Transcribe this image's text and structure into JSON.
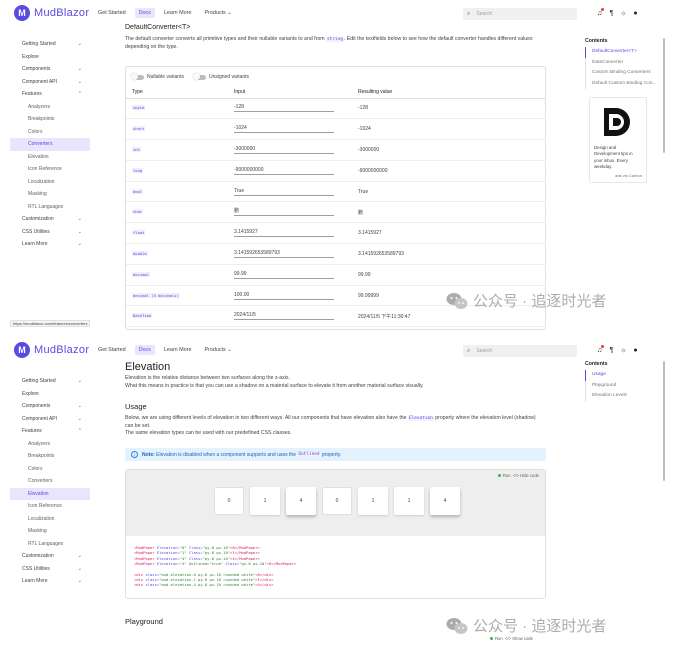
{
  "app": {
    "logo_text": "MudBlazor",
    "nav": [
      "Get Started",
      "Docs",
      "Learn More",
      "Products"
    ],
    "search_placeholder": "Search",
    "nav_chevron": "⌄"
  },
  "sidebar1": [
    {
      "label": "Getting Started",
      "chev": "⌄",
      "sub": false,
      "active": false
    },
    {
      "label": "Explore",
      "chev": "",
      "sub": false,
      "active": false
    },
    {
      "label": "Components",
      "chev": "⌄",
      "sub": false,
      "active": false
    },
    {
      "label": "Component API",
      "chev": "⌄",
      "sub": false,
      "active": false
    },
    {
      "label": "Features",
      "chev": "⌃",
      "sub": false,
      "active": false
    },
    {
      "label": "Analyzers",
      "chev": "",
      "sub": true,
      "active": false
    },
    {
      "label": "Breakpoints",
      "chev": "",
      "sub": true,
      "active": false
    },
    {
      "label": "Colors",
      "chev": "",
      "sub": true,
      "active": false
    },
    {
      "label": "Converters",
      "chev": "",
      "sub": true,
      "active": true
    },
    {
      "label": "Elevation",
      "chev": "",
      "sub": true,
      "active": false
    },
    {
      "label": "Icon Reference",
      "chev": "",
      "sub": true,
      "active": false
    },
    {
      "label": "Localization",
      "chev": "",
      "sub": true,
      "active": false
    },
    {
      "label": "Masking",
      "chev": "",
      "sub": true,
      "active": false
    },
    {
      "label": "RTL Languages",
      "chev": "",
      "sub": true,
      "active": false
    },
    {
      "label": "Customization",
      "chev": "⌄",
      "sub": false,
      "active": false
    },
    {
      "label": "CSS Utilities",
      "chev": "⌄",
      "sub": false,
      "active": false
    },
    {
      "label": "Learn More",
      "chev": "⌄",
      "sub": false,
      "active": false
    }
  ],
  "sidebar2": [
    {
      "label": "Getting Started",
      "chev": "⌄",
      "sub": false,
      "active": false
    },
    {
      "label": "Explore",
      "chev": "",
      "sub": false,
      "active": false
    },
    {
      "label": "Components",
      "chev": "⌄",
      "sub": false,
      "active": false
    },
    {
      "label": "Component API",
      "chev": "⌄",
      "sub": false,
      "active": false
    },
    {
      "label": "Features",
      "chev": "⌃",
      "sub": false,
      "active": false
    },
    {
      "label": "Analyzers",
      "chev": "",
      "sub": true,
      "active": false
    },
    {
      "label": "Breakpoints",
      "chev": "",
      "sub": true,
      "active": false
    },
    {
      "label": "Colors",
      "chev": "",
      "sub": true,
      "active": false
    },
    {
      "label": "Converters",
      "chev": "",
      "sub": true,
      "active": false
    },
    {
      "label": "Elevation",
      "chev": "",
      "sub": true,
      "active": true
    },
    {
      "label": "Icon Reference",
      "chev": "",
      "sub": true,
      "active": false
    },
    {
      "label": "Localization",
      "chev": "",
      "sub": true,
      "active": false
    },
    {
      "label": "Masking",
      "chev": "",
      "sub": true,
      "active": false
    },
    {
      "label": "RTL Languages",
      "chev": "",
      "sub": true,
      "active": false
    },
    {
      "label": "Customization",
      "chev": "⌄",
      "sub": false,
      "active": false
    },
    {
      "label": "CSS Utilities",
      "chev": "⌄",
      "sub": false,
      "active": false
    },
    {
      "label": "Learn More",
      "chev": "⌄",
      "sub": false,
      "active": false
    }
  ],
  "toc1": {
    "title": "Contents",
    "items": [
      {
        "label": "DefaultConverter<T>",
        "active": true
      },
      {
        "label": "DateConverter",
        "active": false
      },
      {
        "label": "Custom Binding Converters",
        "active": false
      },
      {
        "label": "Default Custom Binding Con...",
        "active": false
      }
    ]
  },
  "toc2": {
    "title": "Contents",
    "items": [
      {
        "label": "Usage",
        "active": true
      },
      {
        "label": "Playground",
        "active": false
      },
      {
        "label": "Elevation Levels",
        "active": false
      }
    ]
  },
  "ad": {
    "text": "Design and Development tips in your inbox. Every weekday.",
    "via": "ads via Carbon"
  },
  "converters": {
    "heading_partial": "DefaultConverter<T>",
    "desc_a": "The default converter converts all primitive types and their nullable variants to and from",
    "desc_code": "string",
    "desc_b": ". Edit the textfields below to see how the default converter handles different values depending on the type.",
    "switch_nullable": "Nullable variants",
    "switch_unsigned": "Unsigned variants",
    "headers": [
      "Type",
      "Input",
      "Resulting value"
    ],
    "rows": [
      {
        "type": "sbyte",
        "input": "-128",
        "result": "-128"
      },
      {
        "type": "short",
        "input": "-1024",
        "result": "-1024"
      },
      {
        "type": "int",
        "input": "-3000000",
        "result": "-3000000"
      },
      {
        "type": "long",
        "input": "-9000000000",
        "result": "-9000000000"
      },
      {
        "type": "bool",
        "input": "True",
        "result": "True"
      },
      {
        "type": "char",
        "input": "鹏",
        "result": "鹏"
      },
      {
        "type": "float",
        "input": "3.1415927",
        "result": "3.1415927"
      },
      {
        "type": "double",
        "input": "3.141592653589793",
        "result": "3.141592653589793"
      },
      {
        "type": "decimal",
        "input": "99.99",
        "result": "99.99"
      },
      {
        "type": "decimal (5 decimals)",
        "input": "100.00",
        "result": "99.99999"
      },
      {
        "type": "DateTime",
        "input": "2024/11/5",
        "result": "2024/11/5 下午11:30:47"
      }
    ],
    "url": "https://mudblazor.com/features/converters"
  },
  "elevation": {
    "title": "Elevation",
    "desc1": "Elevation is the relative distance between two surfaces along the z-axis.",
    "desc2": "What this means in practice is that you can use a shadow on a material surface to elevate it from another material surface visually.",
    "usage_title": "Usage",
    "usage_a": "Below, we are using different levels of elevation in two different ways. All our components that have elevation also have the",
    "usage_code": "Elevation",
    "usage_b": "property where the elevation level (shadow) can be set.",
    "usage_c": "The same elevation types can be used with our predefined CSS classes.",
    "note_strong": "Note:",
    "note_a": "Elevation is disabled when a component supports and uses the",
    "note_code": "Outlined",
    "note_b": "property.",
    "run": "Run",
    "hide_code": "Hide code",
    "show_code": "Show code",
    "code_sym": "</>",
    "papers": [
      "0",
      "1",
      "4",
      "0",
      "1",
      "1",
      "4"
    ],
    "code_lines": [
      {
        "t": "<MudPaper",
        "a": " Elevation=",
        "s": "\"0\"",
        "a2": " Class=",
        "s2": "\"py-8 px-10\"",
        "e": ">0</MudPaper>"
      },
      {
        "t": "<MudPaper",
        "a": " Elevation=",
        "s": "\"1\"",
        "a2": " Class=",
        "s2": "\"py-8 px-10\"",
        "e": ">1</MudPaper>"
      },
      {
        "t": "<MudPaper",
        "a": " Elevation=",
        "s": "\"4\"",
        "a2": " Class=",
        "s2": "\"py-8 px-10\"",
        "e": ">4</MudPaper>"
      },
      {
        "t": "<MudPaper",
        "a": " Elevation=",
        "s": "\"4\" Outlined=\"true\"",
        "a2": " Class=",
        "s2": "\"py-8 px-10\"",
        "e": ">0</MudPaper>"
      }
    ],
    "div_lines": [
      {
        "t": "<div",
        "a": " class=",
        "s": "\"mud-elevation-0 py-8 px-10 rounded white\"",
        "e": ">0</div>"
      },
      {
        "t": "<div",
        "a": " class=",
        "s": "\"mud-elevation-1 py-8 px-10 rounded white\"",
        "e": ">1</div>"
      },
      {
        "t": "<div",
        "a": " class=",
        "s": "\"mud-elevation-4 py-8 px-10 rounded white\"",
        "e": ">4</div>"
      }
    ],
    "playground_title": "Playground"
  },
  "watermark": "公众号 · 追逐时光者",
  "colors": {
    "brand": "#594ae2",
    "active_bg": "#e8e6fc"
  }
}
